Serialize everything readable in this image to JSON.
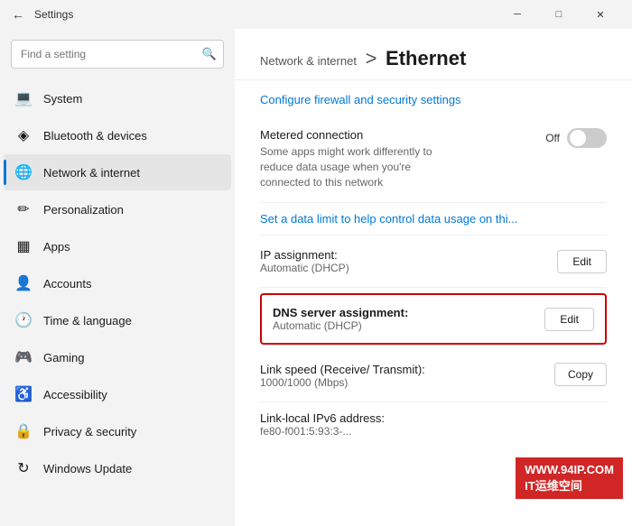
{
  "titlebar": {
    "title": "Settings",
    "back_label": "←",
    "minimize_label": "─",
    "maximize_label": "□",
    "close_label": "✕"
  },
  "search": {
    "placeholder": "Find a setting"
  },
  "nav": {
    "items": [
      {
        "id": "system",
        "label": "System",
        "icon": "💻",
        "active": false
      },
      {
        "id": "bluetooth",
        "label": "Bluetooth & devices",
        "icon": "✦",
        "active": false
      },
      {
        "id": "network",
        "label": "Network & internet",
        "icon": "🌐",
        "active": true
      },
      {
        "id": "personalization",
        "label": "Personalization",
        "icon": "🎨",
        "active": false
      },
      {
        "id": "apps",
        "label": "Apps",
        "icon": "📦",
        "active": false
      },
      {
        "id": "accounts",
        "label": "Accounts",
        "icon": "👤",
        "active": false
      },
      {
        "id": "time",
        "label": "Time & language",
        "icon": "🕐",
        "active": false
      },
      {
        "id": "gaming",
        "label": "Gaming",
        "icon": "🎮",
        "active": false
      },
      {
        "id": "accessibility",
        "label": "Accessibility",
        "icon": "♿",
        "active": false
      },
      {
        "id": "privacy",
        "label": "Privacy & security",
        "icon": "🛡",
        "active": false
      },
      {
        "id": "update",
        "label": "Windows Update",
        "icon": "↻",
        "active": false
      }
    ]
  },
  "header": {
    "section_name": "Network & internet",
    "separator": ">",
    "page_title": "Ethernet"
  },
  "content": {
    "firewall_link": "Configure firewall and security settings",
    "metered_connection": {
      "title": "Metered connection",
      "description": "Some apps might work differently to reduce data usage when you're connected to this network",
      "toggle_label": "Off",
      "toggle_state": "off"
    },
    "data_limit_link": "Set a data limit to help control data usage on thi...",
    "ip_assignment": {
      "title": "IP assignment:",
      "value": "Automatic (DHCP)",
      "edit_label": "Edit"
    },
    "dns_assignment": {
      "title": "DNS server assignment:",
      "value": "Automatic (DHCP)",
      "edit_label": "Edit"
    },
    "link_speed": {
      "title": "Link speed (Receive/ Transmit):",
      "value": "1000/1000 (Mbps)",
      "copy_label": "Copy"
    },
    "ipv6": {
      "title": "Link-local IPv6 address:",
      "value": "fe80-f001:5:93:3-..."
    }
  },
  "watermark": {
    "line1": "WWW.94IP.COM",
    "line2": "IT运维空间"
  }
}
